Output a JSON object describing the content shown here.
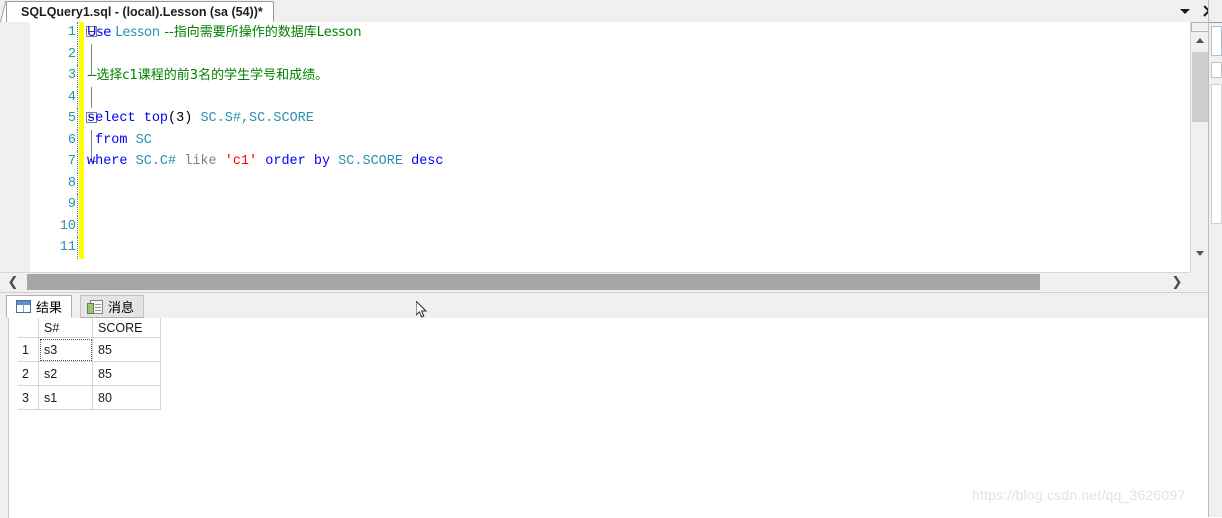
{
  "window": {
    "tab_title": "SQLQuery1.sql - (local).Lesson (sa (54))*",
    "chevron_icon": "chevron-down-icon",
    "close_icon": "close-icon"
  },
  "editor": {
    "lines": [
      {
        "num": "1",
        "fold": "open",
        "segments": [
          {
            "t": "Use ",
            "c": "key"
          },
          {
            "t": "Lesson ",
            "c": "id"
          },
          {
            "t": "--指向需要所操作的数据库Lesson",
            "c": "cmt"
          }
        ]
      },
      {
        "num": "2",
        "fold": "bar",
        "segments": []
      },
      {
        "num": "3",
        "fold": "tick",
        "segments": [
          {
            "t": "--选择c1课程的前3名的学生学号和成绩。",
            "c": "cmt"
          }
        ]
      },
      {
        "num": "4",
        "fold": "bar",
        "segments": []
      },
      {
        "num": "5",
        "fold": "open",
        "segments": [
          {
            "t": "select ",
            "c": "key"
          },
          {
            "t": "top",
            "c": "key"
          },
          {
            "t": "(",
            "c": "plain"
          },
          {
            "t": "3",
            "c": "num"
          },
          {
            "t": ") ",
            "c": "plain"
          },
          {
            "t": "SC.S#,SC.SCORE",
            "c": "id"
          }
        ]
      },
      {
        "num": "6",
        "fold": "bar",
        "segments": [
          {
            "t": " ",
            "c": "plain"
          },
          {
            "t": "from ",
            "c": "key"
          },
          {
            "t": "SC",
            "c": "id"
          }
        ]
      },
      {
        "num": "7",
        "fold": "tick",
        "segments": [
          {
            "t": "where ",
            "c": "key"
          },
          {
            "t": "SC.C# ",
            "c": "id"
          },
          {
            "t": "like ",
            "c": "gray"
          },
          {
            "t": "'c1' ",
            "c": "str"
          },
          {
            "t": "order by ",
            "c": "key"
          },
          {
            "t": "SC.SCORE ",
            "c": "id"
          },
          {
            "t": "desc",
            "c": "key"
          }
        ]
      },
      {
        "num": "8",
        "fold": "none",
        "segments": []
      },
      {
        "num": "9",
        "fold": "none",
        "segments": []
      },
      {
        "num": "10",
        "fold": "none",
        "segments": []
      },
      {
        "num": "11",
        "fold": "none",
        "segments": []
      }
    ],
    "vscroll": {
      "up_icon": "scroll-up-icon",
      "down_icon": "scroll-down-icon"
    },
    "hscroll": {
      "left_label": "❮",
      "right_label": "❯"
    }
  },
  "results": {
    "tabs": [
      {
        "label": "结果",
        "icon": "results-grid-icon",
        "active": true
      },
      {
        "label": "消息",
        "icon": "messages-doc-icon",
        "active": false
      }
    ],
    "columns": [
      "",
      "S#",
      "SCORE"
    ],
    "rows": [
      {
        "n": "1",
        "s": "s3",
        "score": "85"
      },
      {
        "n": "2",
        "s": "s2",
        "score": "85"
      },
      {
        "n": "3",
        "s": "s1",
        "score": "80"
      }
    ]
  },
  "watermark": {
    "text": "https://blog.csdn.net/qq_3626097"
  }
}
